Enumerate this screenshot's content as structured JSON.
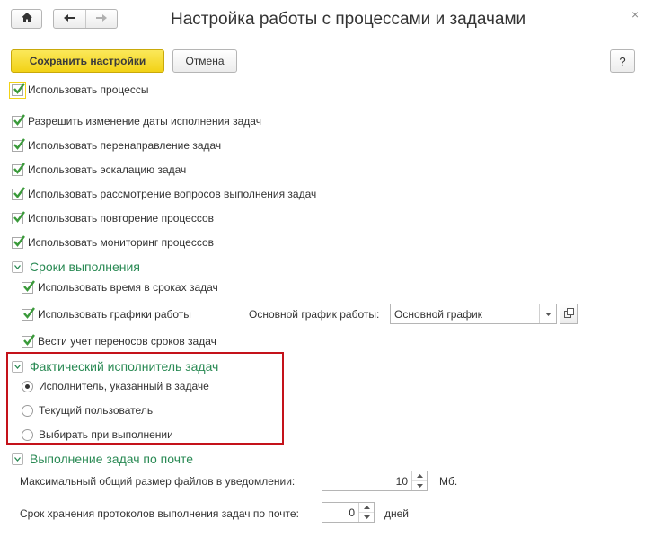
{
  "window": {
    "title": "Настройка работы с процессами и задачами",
    "close_glyph": "×",
    "help_label": "?"
  },
  "nav": {
    "home_icon": "home-icon",
    "back_icon": "arrow-left-icon",
    "forward_icon": "arrow-right-icon"
  },
  "toolbar": {
    "save_label": "Сохранить настройки",
    "cancel_label": "Отмена"
  },
  "options": {
    "use_processes": {
      "label": "Использовать процессы",
      "checked": true
    },
    "items": [
      {
        "label": "Разрешить изменение даты исполнения задач",
        "checked": true
      },
      {
        "label": "Использовать перенаправление задач",
        "checked": true
      },
      {
        "label": "Использовать эскалацию задач",
        "checked": true
      },
      {
        "label": "Использовать рассмотрение вопросов выполнения задач",
        "checked": true
      },
      {
        "label": "Использовать повторение процессов",
        "checked": true
      },
      {
        "label": "Использовать мониторинг процессов",
        "checked": true
      }
    ]
  },
  "deadlines": {
    "title": "Сроки выполнения",
    "use_time": {
      "label": "Использовать время в сроках задач",
      "checked": true
    },
    "use_schedules": {
      "label": "Использовать графики работы",
      "checked": true
    },
    "main_schedule_label": "Основной график работы:",
    "main_schedule_value": "Основной график",
    "track_transfers": {
      "label": "Вести учет переносов сроков задач",
      "checked": true
    }
  },
  "executor": {
    "title": "Фактический исполнитель задач",
    "options": [
      {
        "label": "Исполнитель, указанный в задаче",
        "selected": true
      },
      {
        "label": "Текущий пользователь",
        "selected": false
      },
      {
        "label": "Выбирать при выполнении",
        "selected": false
      }
    ]
  },
  "mail": {
    "title": "Выполнение задач по почте",
    "max_size_label": "Максимальный общий размер файлов в уведомлении:",
    "max_size_value": "10",
    "max_size_unit": "Мб.",
    "retention_label": "Срок хранения протоколов выполнения задач по почте:",
    "retention_value": "0",
    "retention_unit": "дней"
  },
  "colors": {
    "accent_yellow": "#f2d216",
    "group_green": "#2a8a54",
    "check_green": "#3a9a3a",
    "highlight_red": "#c4121a"
  }
}
